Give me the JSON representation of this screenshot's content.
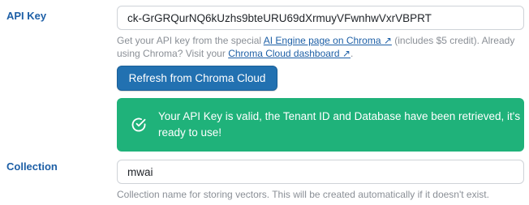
{
  "api_key": {
    "label": "API Key",
    "value": "ck-GrGRQurNQ6kUzhs9bteURU69dXrmuyVFwnhwVxrVBPRT",
    "help_prefix": "Get your API key from the special ",
    "link1_text": "AI Engine page on Chroma ↗",
    "help_middle": " (includes $5 credit). Already using Chroma? Visit your ",
    "link2_text": "Chroma Cloud dashboard ↗",
    "help_suffix": "."
  },
  "refresh_button": {
    "label": "Refresh from Chroma Cloud"
  },
  "success_alert": {
    "icon": "check-circle-icon",
    "message": "Your API Key is valid, the Tenant ID and Database have been retrieved, it's ready to use!"
  },
  "collection": {
    "label": "Collection",
    "value": "mwai",
    "help": "Collection name for storing vectors. This will be created automatically if it doesn't exist."
  },
  "colors": {
    "label_blue": "#1d5fa6",
    "button_blue": "#2271b1",
    "success_green": "#1fb27a",
    "help_gray": "#8a8f96"
  }
}
